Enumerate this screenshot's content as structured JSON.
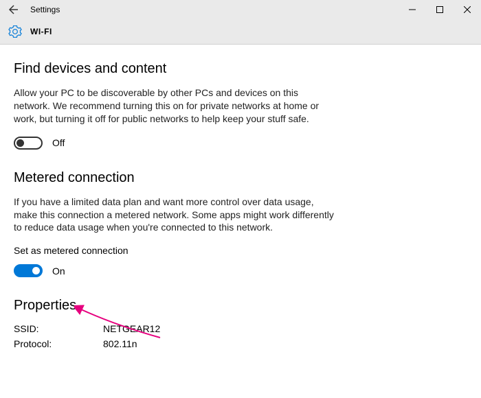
{
  "window": {
    "title": "Settings"
  },
  "page": {
    "title": "WI-FI"
  },
  "sections": {
    "find": {
      "heading": "Find devices and content",
      "desc": "Allow your PC to be discoverable by other PCs and devices on this network. We recommend turning this on for private networks at home or work, but turning it off for public networks to help keep your stuff safe.",
      "toggle_state": "Off"
    },
    "metered": {
      "heading": "Metered connection",
      "desc": "If you have a limited data plan and want more control over data usage, make this connection a metered network. Some apps might work differently to reduce data usage when you're connected to this network.",
      "setting_label": "Set as metered connection",
      "toggle_state": "On"
    },
    "properties": {
      "heading": "Properties",
      "rows": [
        {
          "k": "SSID:",
          "v": "NETGEAR12"
        },
        {
          "k": "Protocol:",
          "v": "802.11n"
        }
      ]
    }
  }
}
